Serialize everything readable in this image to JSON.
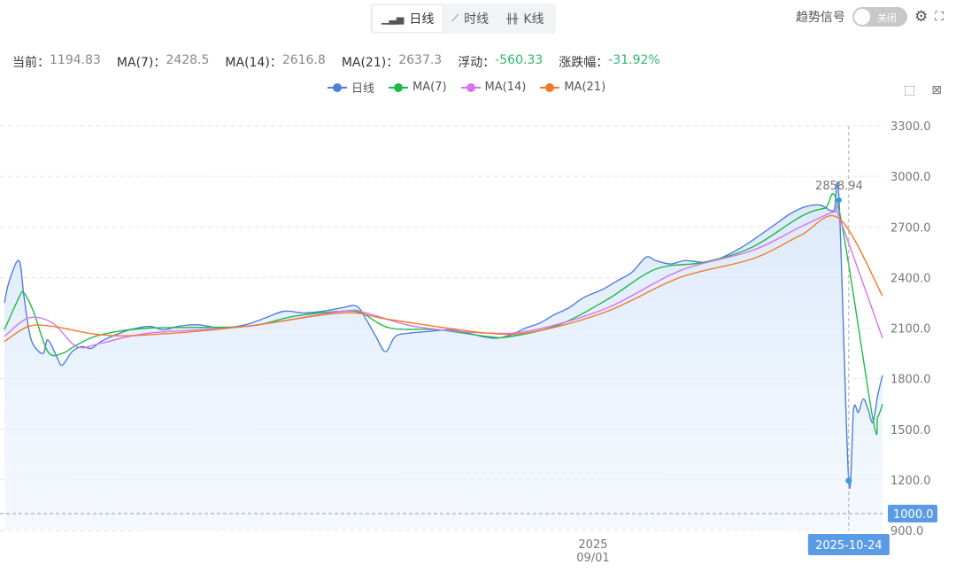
{
  "tabs": [
    {
      "label": "日线",
      "icon": "bar-chart-icon"
    },
    {
      "label": "时线",
      "icon": "line-chart-icon"
    },
    {
      "label": "K线",
      "icon": "candlestick-icon"
    }
  ],
  "trend_signal": {
    "label": "趋势信号",
    "toggle": "关闭"
  },
  "stats": {
    "current_label": "当前：",
    "current": "1194.83",
    "ma7_label": "MA(7)：",
    "ma7": "2428.5",
    "ma14_label": "MA(14)：",
    "ma14": "2616.8",
    "ma21_label": "MA(21)：",
    "ma21": "2637.3",
    "float_label": "浮动：",
    "float": "-560.33",
    "change_label": "涨跌幅：",
    "change": "-31.92%"
  },
  "colors": {
    "daily": "#4e7fdc",
    "ma7": "#1dba45",
    "ma14": "#d873ef",
    "ma21": "#f07a2b",
    "accent": "#5b9be6",
    "up": "#2eb872"
  },
  "chart_data": {
    "type": "line",
    "legend": [
      "日线",
      "MA(7)",
      "MA(14)",
      "MA(21)"
    ],
    "legend_position": "top-center",
    "ylim": [
      900,
      3300
    ],
    "yticks": [
      "3300.0",
      "3000.0",
      "2700.0",
      "2400.0",
      "2100.0",
      "1800.0",
      "1500.0",
      "1200.0",
      "900.0"
    ],
    "xtick": {
      "day": 122,
      "year": "2025",
      "label": "09/01"
    },
    "crosshair": {
      "day": 175,
      "x_label": "2025-10-24",
      "y_value": 1000,
      "y_label": "1000.0"
    },
    "max_label": "2858.94",
    "series": [
      {
        "name": "日线",
        "points": [
          [
            0,
            2250
          ],
          [
            1,
            2380
          ],
          [
            3,
            2500
          ],
          [
            4,
            2300
          ],
          [
            5,
            2100
          ],
          [
            6,
            2000
          ],
          [
            8,
            1950
          ],
          [
            9,
            2030
          ],
          [
            11,
            1920
          ],
          [
            12,
            1880
          ],
          [
            14,
            1960
          ],
          [
            16,
            1990
          ],
          [
            18,
            1980
          ],
          [
            20,
            2020
          ],
          [
            23,
            2060
          ],
          [
            26,
            2090
          ],
          [
            30,
            2110
          ],
          [
            33,
            2090
          ],
          [
            36,
            2110
          ],
          [
            40,
            2120
          ],
          [
            45,
            2100
          ],
          [
            50,
            2120
          ],
          [
            54,
            2160
          ],
          [
            58,
            2200
          ],
          [
            62,
            2190
          ],
          [
            66,
            2200
          ],
          [
            70,
            2220
          ],
          [
            73,
            2230
          ],
          [
            75,
            2150
          ],
          [
            77,
            2050
          ],
          [
            79,
            1960
          ],
          [
            81,
            2050
          ],
          [
            84,
            2070
          ],
          [
            88,
            2080
          ],
          [
            92,
            2090
          ],
          [
            96,
            2070
          ],
          [
            99,
            2050
          ],
          [
            102,
            2040
          ],
          [
            105,
            2060
          ],
          [
            108,
            2100
          ],
          [
            111,
            2130
          ],
          [
            114,
            2180
          ],
          [
            117,
            2220
          ],
          [
            120,
            2280
          ],
          [
            124,
            2330
          ],
          [
            127,
            2380
          ],
          [
            130,
            2430
          ],
          [
            133,
            2520
          ],
          [
            135,
            2500
          ],
          [
            138,
            2480
          ],
          [
            141,
            2500
          ],
          [
            145,
            2490
          ],
          [
            148,
            2510
          ],
          [
            151,
            2550
          ],
          [
            154,
            2600
          ],
          [
            157,
            2660
          ],
          [
            160,
            2720
          ],
          [
            163,
            2780
          ],
          [
            166,
            2820
          ],
          [
            169,
            2830
          ],
          [
            171,
            2800
          ],
          [
            172,
            2800
          ],
          [
            173,
            2858.94
          ],
          [
            175,
            1194.83
          ],
          [
            176,
            1620
          ],
          [
            177,
            1600
          ],
          [
            178,
            1680
          ],
          [
            179,
            1620
          ],
          [
            180,
            1540
          ],
          [
            181,
            1700
          ],
          [
            182,
            1820
          ]
        ]
      },
      {
        "name": "MA(7)",
        "points": [
          [
            0,
            2090
          ],
          [
            3,
            2280
          ],
          [
            4,
            2310
          ],
          [
            6,
            2200
          ],
          [
            9,
            1960
          ],
          [
            12,
            1950
          ],
          [
            15,
            2000
          ],
          [
            20,
            2060
          ],
          [
            30,
            2100
          ],
          [
            50,
            2110
          ],
          [
            60,
            2170
          ],
          [
            70,
            2200
          ],
          [
            74,
            2190
          ],
          [
            80,
            2100
          ],
          [
            90,
            2090
          ],
          [
            100,
            2050
          ],
          [
            105,
            2050
          ],
          [
            115,
            2120
          ],
          [
            125,
            2270
          ],
          [
            135,
            2450
          ],
          [
            145,
            2490
          ],
          [
            155,
            2580
          ],
          [
            165,
            2760
          ],
          [
            170,
            2810
          ],
          [
            173,
            2800
          ],
          [
            180,
            1560
          ],
          [
            181,
            1570
          ],
          [
            182,
            1650
          ]
        ]
      },
      {
        "name": "MA(14)",
        "points": [
          [
            0,
            2050
          ],
          [
            5,
            2160
          ],
          [
            10,
            2130
          ],
          [
            15,
            1990
          ],
          [
            20,
            2010
          ],
          [
            30,
            2070
          ],
          [
            50,
            2110
          ],
          [
            70,
            2200
          ],
          [
            75,
            2190
          ],
          [
            85,
            2110
          ],
          [
            100,
            2070
          ],
          [
            110,
            2090
          ],
          [
            125,
            2220
          ],
          [
            140,
            2440
          ],
          [
            155,
            2560
          ],
          [
            165,
            2700
          ],
          [
            172,
            2790
          ],
          [
            173,
            2760
          ],
          [
            182,
            2040
          ]
        ]
      },
      {
        "name": "MA(21)",
        "points": [
          [
            0,
            2020
          ],
          [
            5,
            2110
          ],
          [
            10,
            2110
          ],
          [
            20,
            2060
          ],
          [
            30,
            2060
          ],
          [
            50,
            2110
          ],
          [
            70,
            2190
          ],
          [
            80,
            2150
          ],
          [
            100,
            2070
          ],
          [
            110,
            2080
          ],
          [
            125,
            2200
          ],
          [
            140,
            2400
          ],
          [
            155,
            2510
          ],
          [
            165,
            2650
          ],
          [
            173,
            2750
          ],
          [
            182,
            2290
          ]
        ]
      }
    ]
  }
}
